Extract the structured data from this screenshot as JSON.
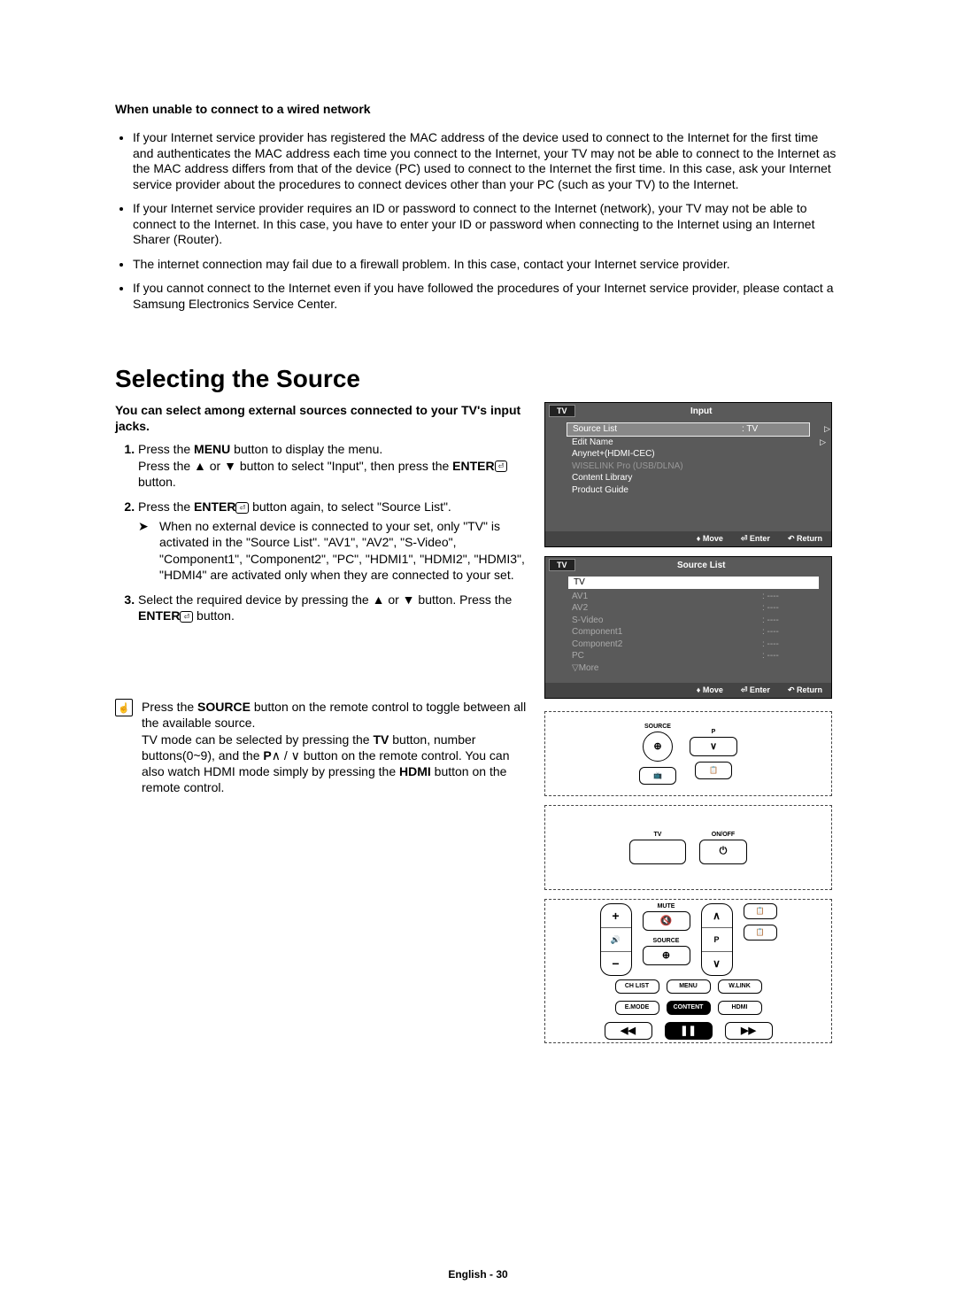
{
  "troubleshoot": {
    "title": "When unable to connect to a wired network",
    "bullets": [
      "If your Internet service provider has registered the MAC address of the device used to connect to the Internet for the first time and authenticates the MAC address each time you connect to the Internet, your TV may not be able to connect to the Internet as the MAC address differs from that of the device (PC) used to connect to the Internet the first time. In this case, ask your Internet service provider about the procedures to connect devices other than your PC (such as your TV) to the Internet.",
      "If your Internet service provider requires an ID or password to connect to the Internet (network), your TV may not be able to connect to the Internet. In this case, you have to enter your ID or password when connecting to the Internet using an Internet Sharer (Router).",
      "The internet connection may fail due to a firewall problem. In this case, contact your Internet service provider.",
      "If you cannot connect to the Internet even if you have followed the procedures of your Internet service provider, please contact a Samsung Electronics Service Center."
    ]
  },
  "source": {
    "heading": "Selecting the Source",
    "intro": "You can select among external sources connected to your TV's input jacks.",
    "step1_a": "Press the ",
    "step1_menu": "MENU",
    "step1_b": " button to display the menu.",
    "step1_c": "Press the ▲ or ▼ button to select \"Input\", then press the ",
    "step1_enter": "ENTER",
    "step1_d": " button.",
    "step2_a": "Press the ",
    "step2_enter": "ENTER",
    "step2_b": " button again, to select \"Source List\".",
    "step2_note_a": "When no external device is connected to your set, only \"TV\" is activated in the \"Source List\". \"AV1\", \"AV2\", \"S-Video\", \"Component1\", \"Component2\", \"PC\", \"HDMI1\", \"HDMI2\", \"HDMI3\", \"HDMI4\" are activated only when they are connected to your set.",
    "step3_a": "Select the required device by pressing the ▲ or ▼ button. Press the ",
    "step3_enter": "ENTER",
    "step3_b": " button.",
    "remote_tip_a": "Press the ",
    "remote_tip_source": "SOURCE",
    "remote_tip_b": " button on the remote control to toggle between all the available source.",
    "remote_tip_c": "TV mode can be selected by pressing the ",
    "remote_tip_tv": "TV",
    "remote_tip_d": " button, number buttons(0~9), and the ",
    "remote_tip_p": "P",
    "remote_tip_e": "∧ / ∨ button on the remote control. You can also watch HDMI mode simply by pressing the ",
    "remote_tip_hdmi": "HDMI",
    "remote_tip_f": " button on the remote control."
  },
  "osd_input": {
    "tv": "TV",
    "title": "Input",
    "source_list_label": "Source List",
    "source_list_value": ": TV",
    "edit_name": "Edit Name",
    "anynet": "Anynet+(HDMI-CEC)",
    "wiselink": "WISELINK Pro (USB/DLNA)",
    "content_library": "Content Library",
    "product_guide": "Product Guide",
    "move": "Move",
    "enter": "Enter",
    "return": "Return",
    "arrow_sym": "▷",
    "updown_sym": "♦",
    "enter_sym": "⏎",
    "return_sym": "↶"
  },
  "osd_source": {
    "tv": "TV",
    "title": "Source List",
    "selected": "TV",
    "av1": "AV1",
    "av2": "AV2",
    "svideo": "S-Video",
    "comp1": "Component1",
    "comp2": "Component2",
    "pc": "PC",
    "more": "▽More",
    "dashes": ": ----",
    "move": "Move",
    "enter": "Enter",
    "return": "Return"
  },
  "remote": {
    "source": "SOURCE",
    "p": "P",
    "tv": "TV",
    "onoff": "ON/OFF",
    "mute": "MUTE",
    "chlist": "CH LIST",
    "menu": "MENU",
    "wlink": "W.LINK",
    "emode": "E.MODE",
    "content": "CONTENT",
    "hdmi": "HDMI",
    "plus": "+",
    "minus": "−",
    "mute_sym": "🔇",
    "up": "∧",
    "down": "∨",
    "rev": "◀◀",
    "pause": "❚❚",
    "fwd": "▶▶",
    "power": "⏻"
  },
  "footer": "English - 30",
  "glyphs": {
    "remote_hand": "☝"
  }
}
